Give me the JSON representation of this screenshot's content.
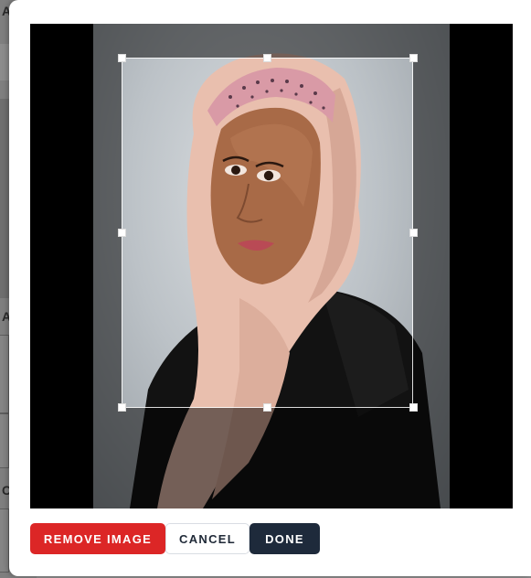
{
  "background_page": {
    "letters": [
      "A",
      "A",
      "C"
    ]
  },
  "cropper": {
    "image_alt": "Portrait of a woman wearing a pink hijab"
  },
  "actions": {
    "remove_label": "REMOVE IMAGE",
    "cancel_label": "CANCEL",
    "done_label": "DONE"
  },
  "colors": {
    "remove": "#dc2626",
    "done": "#1e2a3b",
    "stage": "#000000"
  }
}
